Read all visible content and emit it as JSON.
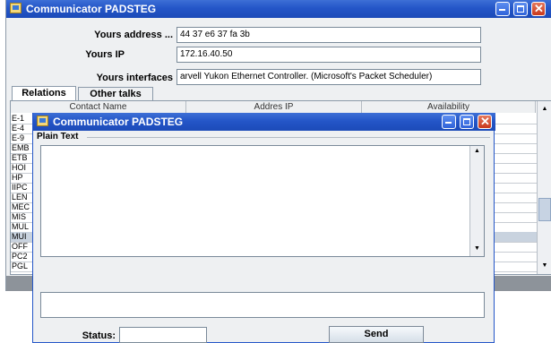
{
  "main_window": {
    "title": "Communicator PADSTEG",
    "form": {
      "address_label": "Yours address ...",
      "address_value": "44 37 e6 37  fa 3b",
      "ip_label": "Yours IP",
      "ip_value": "172.16.40.50",
      "interfaces_label": "Yours interfaces",
      "interfaces_value": "arvell Yukon Ethernet Controller. (Microsoft's Packet Scheduler)"
    },
    "tabs": [
      {
        "label": "Relations",
        "active": true
      },
      {
        "label": "Other talks",
        "active": false
      }
    ],
    "table": {
      "columns": [
        "Contact Name",
        "Addres IP",
        "Availability"
      ],
      "rows": [
        "E-1",
        "E-4",
        "E-9",
        "EMB",
        "ETB",
        "HOI",
        "HP",
        "IIPC",
        "LEN",
        "MEC",
        "MIS",
        "MUL",
        "MUI",
        "OFF",
        "PC2",
        "PGL"
      ],
      "selected_row_index": 12
    }
  },
  "dialog": {
    "title": "Communicator PADSTEG",
    "section_label": "Plain Text",
    "plain_text": "",
    "message_value": "",
    "status_label": "Status:",
    "status_value": "",
    "send_label": "Send"
  },
  "colors": {
    "titlebar": "#2456c8",
    "panel_bg": "#eef0f2",
    "row_selected": "#c9d3df",
    "close_button": "#c9381c"
  }
}
